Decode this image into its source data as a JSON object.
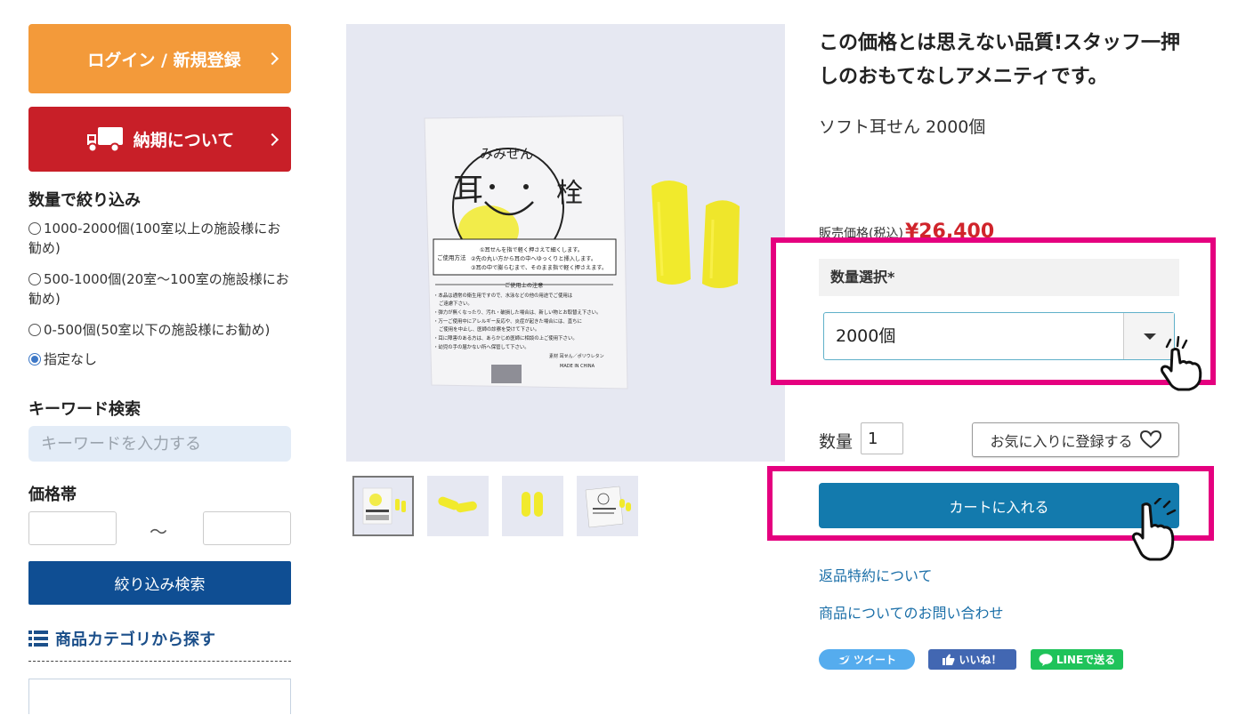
{
  "sidebar": {
    "login_label": "ログイン / 新規登録",
    "delivery_label": "納期について",
    "quantity_filter": {
      "heading": "数量で絞り込み",
      "options": [
        {
          "label": "1000-2000個(100室以上の施設様にお勧め)",
          "checked": false
        },
        {
          "label": "500-1000個(20室〜100室の施設様にお勧め)",
          "checked": false
        },
        {
          "label": "0-500個(50室以下の施設様にお勧め)",
          "checked": false
        },
        {
          "label": "指定なし",
          "checked": true
        }
      ]
    },
    "keyword": {
      "heading": "キーワード検索",
      "placeholder": "キーワードを入力する"
    },
    "price": {
      "heading": "価格帯",
      "separator": "〜"
    },
    "filter_button": "絞り込み検索",
    "category_heading": "商品カテゴリから探す"
  },
  "gallery": {
    "package_text": {
      "brand_kana": "みみせん",
      "brand_char_left": "耳",
      "brand_char_right": "栓",
      "usage_label": "ご使用方法",
      "usage_lines": [
        "①耳せんを指で軽く押さえて細くします。",
        "②先の丸い方から耳の中へゆっくりと挿入します。",
        "③耳の中で膨らむまで、そのまま指で軽く押さえます。"
      ],
      "caution_title": "ご使用上の注意",
      "caution_lines": [
        "・本品は通常の衛生用ですので、水泳などの他の用途でご使用は",
        "ご遠慮下さい。",
        "・弾力が無くなったり、汚れ・破損した場合は、新しい物とお取替え下さい。",
        "・万一ご使用中にアレルギー反応や、炎症が起きた場合には、直ちに",
        "ご使用を中止し、医師の診察を受けて下さい。",
        "・耳に障害のある方は、あらかじめ医師に相談の上ご使用下さい。",
        "・幼児の手の届かない所へ保管して下さい。"
      ],
      "material": "素材 耳せん／ポリウレタン",
      "made_in": "MADE IN CHINA"
    },
    "thumbnail_count": 4
  },
  "product": {
    "headline": "この価格とは思えない品質!スタッフ一押しのおもてなしアメニティです。",
    "name": "ソフト耳せん 2000個",
    "price_label": "販売価格(税込)",
    "price_value": "¥26,400",
    "quantity_select_label": "数量選択*",
    "quantity_select_value": "2000個",
    "quantity_label": "数量",
    "quantity_value": "1",
    "favorite_label": "お気に入りに登録する",
    "cart_label": "カートに入れる",
    "links": [
      "返品特約について",
      "商品についてのお問い合わせ"
    ],
    "social": {
      "tweet": "ツイート",
      "like": "いいね！",
      "line": "LINEで送る"
    }
  },
  "colors": {
    "login_orange": "#f39a3a",
    "delivery_red": "#c81f28",
    "filter_navy": "#0f4e93",
    "cart_blue": "#137aad",
    "highlight_magenta": "#e5007f",
    "price_red": "#d0242b"
  }
}
